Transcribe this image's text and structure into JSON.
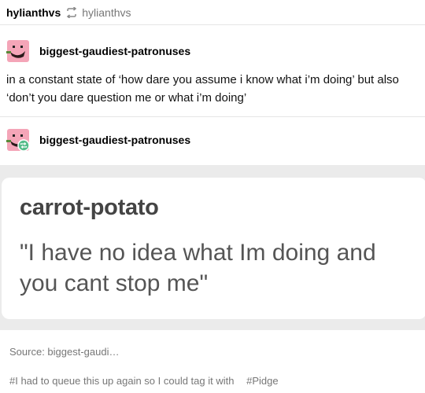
{
  "header": {
    "reblogger": "hylianthvs",
    "reblog_icon": "reblog-icon",
    "source": "hylianthvs"
  },
  "post": {
    "author": "biggest-gaudiest-patronuses",
    "avatar_icon": "pink-smiley-avatar",
    "text": "in a constant state of ‘how dare you assume i know what i’m doing’ but also ‘don’t you dare question me or what i’m doing’"
  },
  "reblog": {
    "author": "biggest-gaudiest-patronuses",
    "avatar_icon": "pink-smiley-avatar",
    "badge_icon": "reblog-badge-icon",
    "badge_color": "#56bc8a"
  },
  "image_card": {
    "username": "carrot-potato",
    "quote": "\"I have no idea what Im doing and you cant stop me\""
  },
  "footer": {
    "source": "Source: biggest-gaudi…",
    "tags": [
      "#I had to queue this up again so I could tag it with",
      "#Pidge"
    ]
  }
}
